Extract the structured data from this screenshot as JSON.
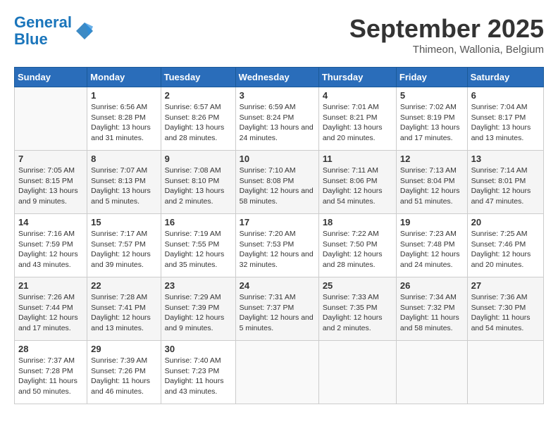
{
  "header": {
    "logo_line1": "General",
    "logo_line2": "Blue",
    "month": "September 2025",
    "location": "Thimeon, Wallonia, Belgium"
  },
  "days_of_week": [
    "Sunday",
    "Monday",
    "Tuesday",
    "Wednesday",
    "Thursday",
    "Friday",
    "Saturday"
  ],
  "weeks": [
    [
      {
        "num": "",
        "empty": true
      },
      {
        "num": "1",
        "rise": "6:56 AM",
        "set": "8:28 PM",
        "daylight": "13 hours and 31 minutes."
      },
      {
        "num": "2",
        "rise": "6:57 AM",
        "set": "8:26 PM",
        "daylight": "13 hours and 28 minutes."
      },
      {
        "num": "3",
        "rise": "6:59 AM",
        "set": "8:24 PM",
        "daylight": "13 hours and 24 minutes."
      },
      {
        "num": "4",
        "rise": "7:01 AM",
        "set": "8:21 PM",
        "daylight": "13 hours and 20 minutes."
      },
      {
        "num": "5",
        "rise": "7:02 AM",
        "set": "8:19 PM",
        "daylight": "13 hours and 17 minutes."
      },
      {
        "num": "6",
        "rise": "7:04 AM",
        "set": "8:17 PM",
        "daylight": "13 hours and 13 minutes."
      }
    ],
    [
      {
        "num": "7",
        "rise": "7:05 AM",
        "set": "8:15 PM",
        "daylight": "13 hours and 9 minutes."
      },
      {
        "num": "8",
        "rise": "7:07 AM",
        "set": "8:13 PM",
        "daylight": "13 hours and 5 minutes."
      },
      {
        "num": "9",
        "rise": "7:08 AM",
        "set": "8:10 PM",
        "daylight": "13 hours and 2 minutes."
      },
      {
        "num": "10",
        "rise": "7:10 AM",
        "set": "8:08 PM",
        "daylight": "12 hours and 58 minutes."
      },
      {
        "num": "11",
        "rise": "7:11 AM",
        "set": "8:06 PM",
        "daylight": "12 hours and 54 minutes."
      },
      {
        "num": "12",
        "rise": "7:13 AM",
        "set": "8:04 PM",
        "daylight": "12 hours and 51 minutes."
      },
      {
        "num": "13",
        "rise": "7:14 AM",
        "set": "8:01 PM",
        "daylight": "12 hours and 47 minutes."
      }
    ],
    [
      {
        "num": "14",
        "rise": "7:16 AM",
        "set": "7:59 PM",
        "daylight": "12 hours and 43 minutes."
      },
      {
        "num": "15",
        "rise": "7:17 AM",
        "set": "7:57 PM",
        "daylight": "12 hours and 39 minutes."
      },
      {
        "num": "16",
        "rise": "7:19 AM",
        "set": "7:55 PM",
        "daylight": "12 hours and 35 minutes."
      },
      {
        "num": "17",
        "rise": "7:20 AM",
        "set": "7:53 PM",
        "daylight": "12 hours and 32 minutes."
      },
      {
        "num": "18",
        "rise": "7:22 AM",
        "set": "7:50 PM",
        "daylight": "12 hours and 28 minutes."
      },
      {
        "num": "19",
        "rise": "7:23 AM",
        "set": "7:48 PM",
        "daylight": "12 hours and 24 minutes."
      },
      {
        "num": "20",
        "rise": "7:25 AM",
        "set": "7:46 PM",
        "daylight": "12 hours and 20 minutes."
      }
    ],
    [
      {
        "num": "21",
        "rise": "7:26 AM",
        "set": "7:44 PM",
        "daylight": "12 hours and 17 minutes."
      },
      {
        "num": "22",
        "rise": "7:28 AM",
        "set": "7:41 PM",
        "daylight": "12 hours and 13 minutes."
      },
      {
        "num": "23",
        "rise": "7:29 AM",
        "set": "7:39 PM",
        "daylight": "12 hours and 9 minutes."
      },
      {
        "num": "24",
        "rise": "7:31 AM",
        "set": "7:37 PM",
        "daylight": "12 hours and 5 minutes."
      },
      {
        "num": "25",
        "rise": "7:33 AM",
        "set": "7:35 PM",
        "daylight": "12 hours and 2 minutes."
      },
      {
        "num": "26",
        "rise": "7:34 AM",
        "set": "7:32 PM",
        "daylight": "11 hours and 58 minutes."
      },
      {
        "num": "27",
        "rise": "7:36 AM",
        "set": "7:30 PM",
        "daylight": "11 hours and 54 minutes."
      }
    ],
    [
      {
        "num": "28",
        "rise": "7:37 AM",
        "set": "7:28 PM",
        "daylight": "11 hours and 50 minutes."
      },
      {
        "num": "29",
        "rise": "7:39 AM",
        "set": "7:26 PM",
        "daylight": "11 hours and 46 minutes."
      },
      {
        "num": "30",
        "rise": "7:40 AM",
        "set": "7:23 PM",
        "daylight": "11 hours and 43 minutes."
      },
      {
        "num": "",
        "empty": true
      },
      {
        "num": "",
        "empty": true
      },
      {
        "num": "",
        "empty": true
      },
      {
        "num": "",
        "empty": true
      }
    ]
  ],
  "labels": {
    "sunrise": "Sunrise:",
    "sunset": "Sunset:",
    "daylight": "Daylight:"
  }
}
